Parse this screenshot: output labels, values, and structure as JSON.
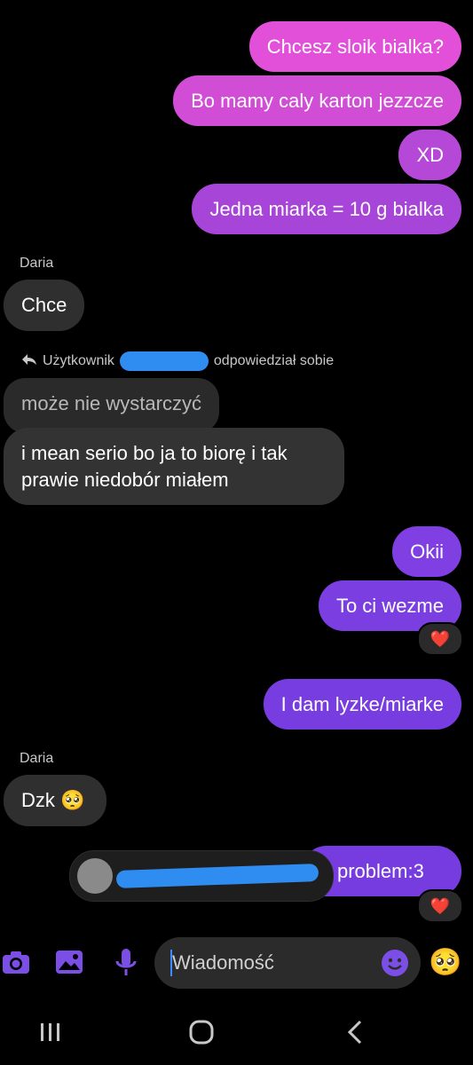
{
  "colors": {
    "bubble_out_top": "#e84fd6",
    "bubble_out_bottom": "#7a3ee0",
    "bubble_in": "#2f2f2f",
    "accent": "#7b4fe6"
  },
  "messages_top": [
    {
      "text": "Chcesz sloik bialka?"
    },
    {
      "text": "Bo mamy caly karton jezzcze"
    },
    {
      "text": "XD"
    },
    {
      "text": "Jedna miarka = 10 g bialka"
    }
  ],
  "daria1": {
    "sender": "Daria",
    "text": "Chce"
  },
  "reply": {
    "prefix": "Użytkownik",
    "suffix": "odpowiedział sobie"
  },
  "quoted": {
    "text": "może nie wystarczyć"
  },
  "long_msg": {
    "line1": "i mean serio bo ja to biorę i tak",
    "line2": "prawie niedobór miałem"
  },
  "okii": {
    "text": "Okii"
  },
  "wezme": {
    "text": "To ci wezme",
    "reaction": "❤️"
  },
  "lyzke": {
    "text": "I dam lyzke/miarke"
  },
  "daria2": {
    "sender": "Daria",
    "text": "Dzk",
    "emoji": "🥺"
  },
  "problem": {
    "text": "problem:3",
    "reaction": "❤️"
  },
  "composer": {
    "placeholder": "Wiadomość",
    "emoji": "🥺"
  }
}
